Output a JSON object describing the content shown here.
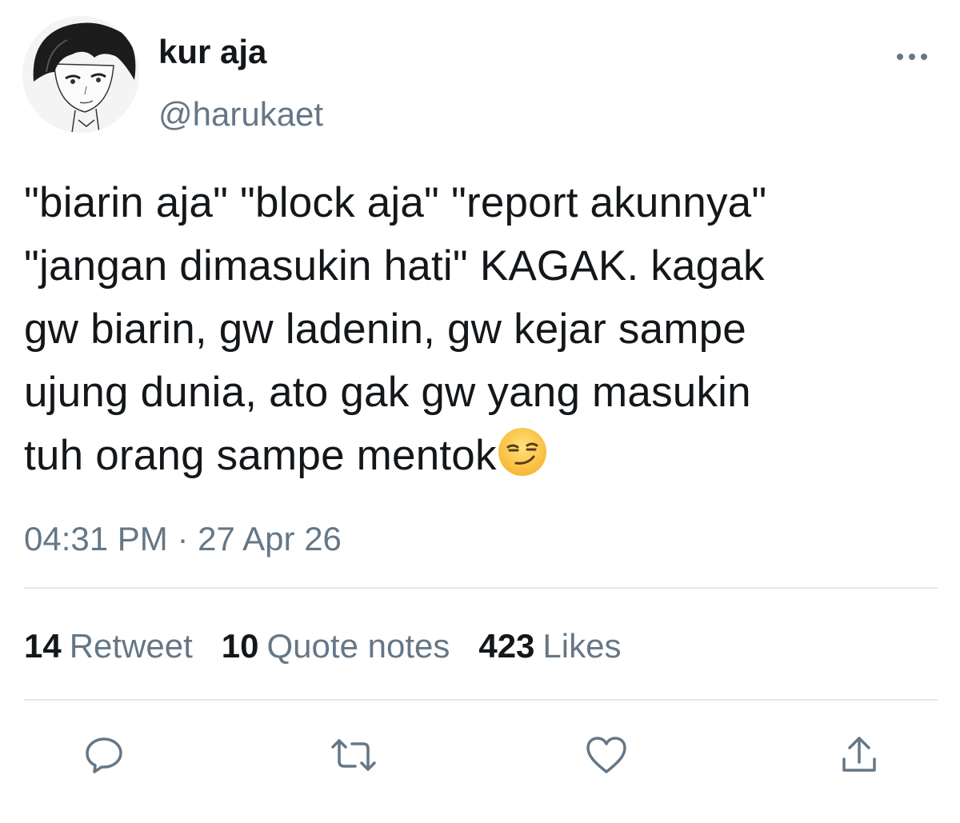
{
  "author": {
    "display_name": "kur aja",
    "handle": "@harukaet",
    "avatar_icon": "anime-boy-avatar"
  },
  "tweet": {
    "text": "\"biarin aja\" \"block aja\" \"report akunnya\"\n\"jangan dimasukin hati\" KAGAK. kagak\ngw biarin, gw ladenin, gw kejar sampe\nujung dunia, ato gak gw yang masukin\ntuh orang sampe mentok",
    "emoji": "smirking-face",
    "timestamp": "04:31 PM · 27 Apr 26"
  },
  "stats": {
    "retweets": {
      "count": "14",
      "label": "Retweet"
    },
    "quotes": {
      "count": "10",
      "label": "Quote notes"
    },
    "likes": {
      "count": "423",
      "label": "Likes"
    }
  },
  "actions": [
    "reply-icon",
    "retweet-icon",
    "like-icon",
    "share-icon"
  ],
  "colors": {
    "text": "#14171a",
    "secondary": "#657786",
    "divider": "#e1e8ed",
    "icon": "#657786"
  }
}
